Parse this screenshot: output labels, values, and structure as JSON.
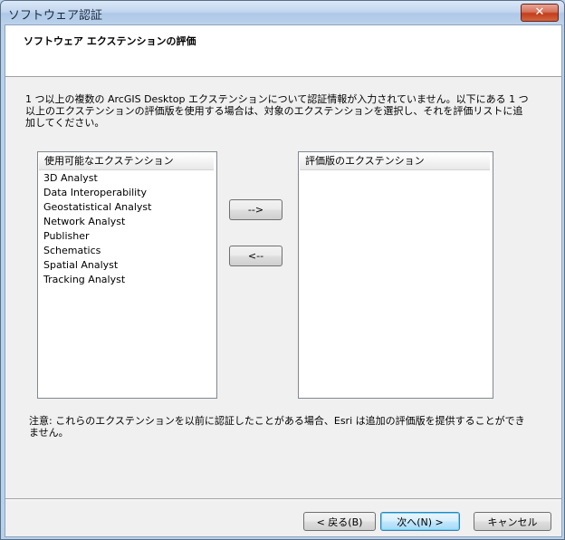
{
  "window": {
    "title": "ソフトウェア認証",
    "close_glyph": "✕"
  },
  "header": {
    "title": "ソフトウェア エクステンションの評価"
  },
  "description": "1 つ以上の複数の ArcGIS Desktop エクステンションについて認証情報が入力されていません。以下にある 1 つ以上のエクステンションの評価版を使用する場合は、対象のエクステンションを選択し、それを評価リストに追加してください。",
  "available_list": {
    "header": "使用可能なエクステンション",
    "items": [
      "3D Analyst",
      "Data Interoperability",
      "Geostatistical Analyst",
      "Network Analyst",
      "Publisher",
      "Schematics",
      "Spatial Analyst",
      "Tracking Analyst"
    ]
  },
  "evaluation_list": {
    "header": "評価版のエクステンション",
    "items": []
  },
  "transfer_buttons": {
    "add_label": "-->",
    "remove_label": "<--"
  },
  "note": "注意: これらのエクステンションを以前に認証したことがある場合、Esri は追加の評価版を提供することができません。",
  "footer": {
    "back_label": "< 戻る(B)",
    "next_label": "次へ(N) >",
    "cancel_label": "キャンセル"
  }
}
